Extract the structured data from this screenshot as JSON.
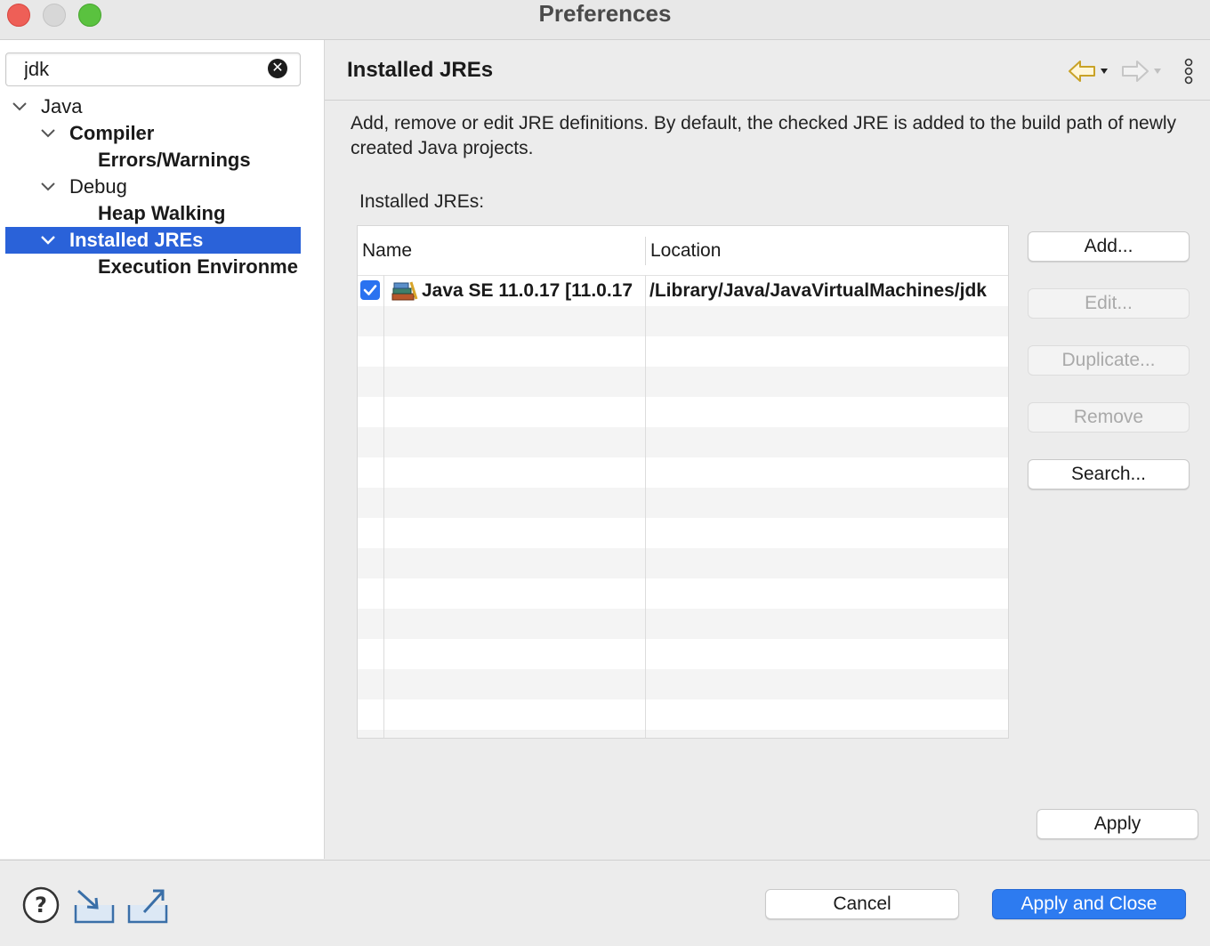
{
  "window": {
    "title": "Preferences"
  },
  "filter": {
    "value": "jdk"
  },
  "tree": {
    "items": [
      {
        "label": "Java",
        "bold": false,
        "expanded": true
      },
      {
        "label": "Compiler",
        "bold": true,
        "expanded": true
      },
      {
        "label": "Errors/Warnings",
        "bold": true
      },
      {
        "label": "Debug",
        "bold": false,
        "expanded": true
      },
      {
        "label": "Heap Walking",
        "bold": true
      },
      {
        "label": "Installed JREs",
        "bold": true,
        "expanded": true,
        "selected": true
      },
      {
        "label": "Execution Environme",
        "bold": true
      }
    ]
  },
  "page": {
    "title": "Installed JREs",
    "description": "Add, remove or edit JRE definitions. By default, the checked JRE is added to the build path of newly created Java projects.",
    "list_label": "Installed JREs:"
  },
  "table": {
    "columns": [
      "Name",
      "Location"
    ],
    "rows": [
      {
        "checked": true,
        "name": "Java SE 11.0.17 [11.0.17",
        "location": "/Library/Java/JavaVirtualMachines/jdk"
      }
    ]
  },
  "buttons": {
    "add": "Add...",
    "edit": "Edit...",
    "duplicate": "Duplicate...",
    "remove": "Remove",
    "search": "Search...",
    "apply": "Apply",
    "cancel": "Cancel",
    "apply_and_close": "Apply and Close"
  },
  "icons": {
    "help": "help-icon",
    "import": "import-icon",
    "export": "export-icon",
    "back": "back-arrow-icon",
    "forward": "forward-arrow-icon",
    "menu": "view-menu-icon",
    "clear": "clear-search-icon",
    "jre": "jre-library-icon"
  },
  "colors": {
    "accent": "#2a62d9",
    "primary_button": "#2d7bf0",
    "back_arrow": "#c9a227"
  }
}
